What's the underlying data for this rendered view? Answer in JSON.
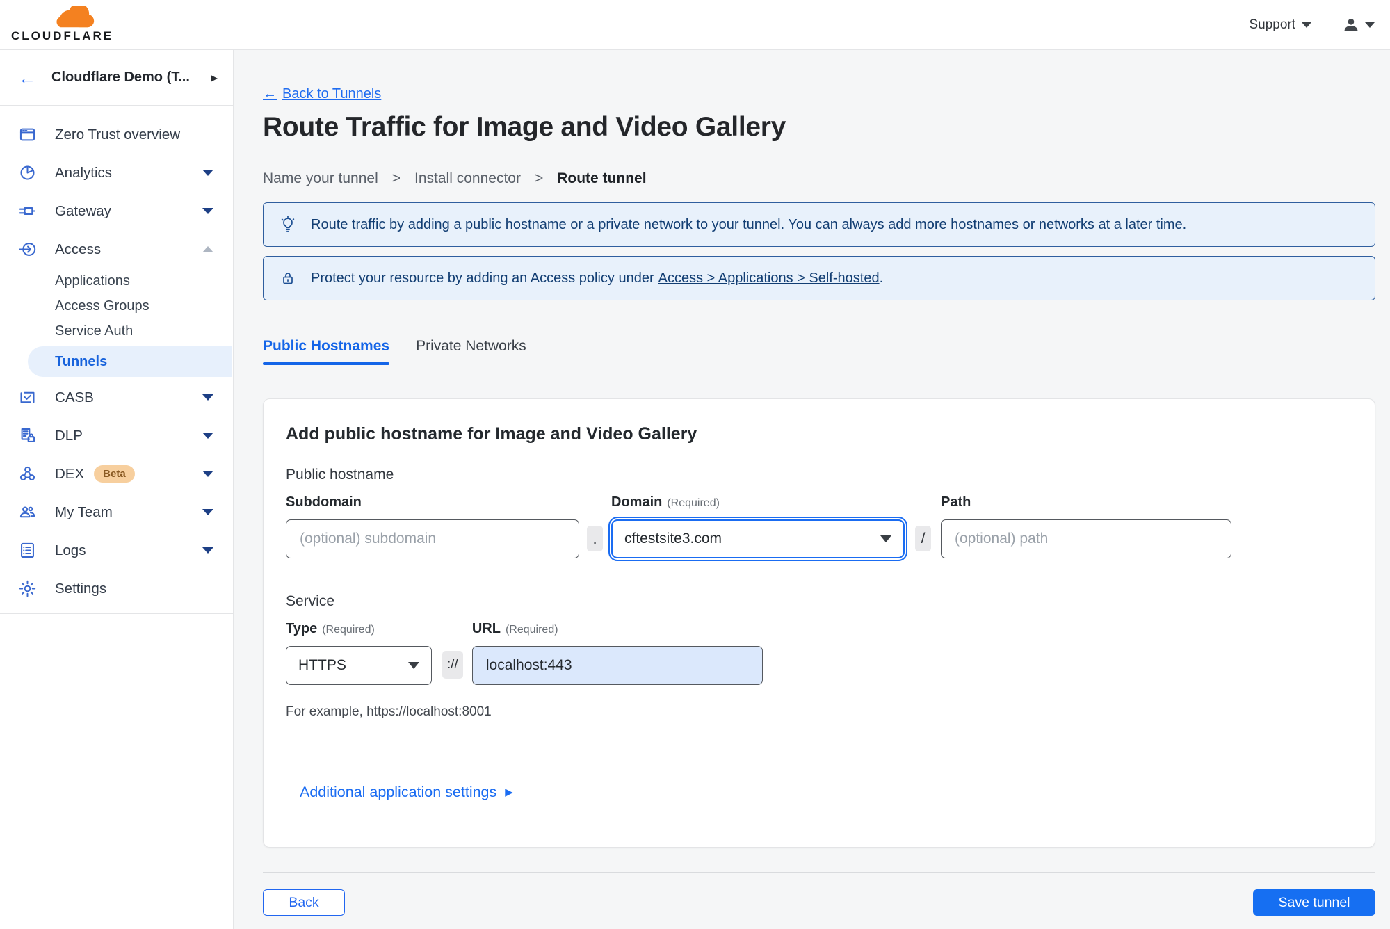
{
  "colors": {
    "accent_blue": "#1a6cf2",
    "save_button_blue": "#166ff2",
    "banner_bg": "#e8f1fb",
    "banner_border": "#2f5e9e",
    "banner_text": "#123e73",
    "sidebar_icon_blue": "#3968cf",
    "active_pill_bg": "#e7f0fc",
    "beta_badge_bg": "#f7cf9e",
    "url_input_bg": "#dbe8fc"
  },
  "icons": {
    "back_arrow": "←",
    "chevron_right": "▶",
    "breadcrumb_sep": ">",
    "details_caret": "▶"
  },
  "header": {
    "brand": "CLOUDFLARE",
    "support_label": "Support"
  },
  "sidebar": {
    "account": "Cloudflare Demo (T...",
    "items": [
      {
        "label": "Zero Trust overview"
      },
      {
        "label": "Analytics"
      },
      {
        "label": "Gateway"
      },
      {
        "label": "Access"
      },
      {
        "label": "CASB"
      },
      {
        "label": "DLP"
      },
      {
        "label": "DEX",
        "badge": "Beta"
      },
      {
        "label": "My Team"
      },
      {
        "label": "Logs"
      },
      {
        "label": "Settings"
      }
    ],
    "access_subitems": [
      {
        "label": "Applications"
      },
      {
        "label": "Access Groups"
      },
      {
        "label": "Service Auth"
      },
      {
        "label": "Tunnels"
      }
    ]
  },
  "main": {
    "back_link": "Back to Tunnels",
    "title": "Route Traffic for Image and Video Gallery",
    "steps": [
      {
        "label": "Name your tunnel"
      },
      {
        "label": "Install connector"
      },
      {
        "label": "Route tunnel"
      }
    ],
    "banners": [
      {
        "text": "Route traffic by adding a public hostname or a private network to your tunnel. You can always add more hostnames or networks at a later time."
      },
      {
        "prefix": "Protect your resource by adding an Access policy under",
        "link": "Access > Applications > Self-hosted",
        "suffix": "."
      }
    ],
    "tabs": [
      {
        "label": "Public Hostnames"
      },
      {
        "label": "Private Networks"
      }
    ],
    "card": {
      "title": "Add public hostname for Image and Video Gallery",
      "hostname_section": "Public hostname",
      "required_label": "(Required)",
      "subdomain": {
        "label": "Subdomain",
        "placeholder": "(optional) subdomain"
      },
      "dot_separator": ".",
      "domain": {
        "label": "Domain",
        "value": "cftestsite3.com"
      },
      "slash_separator": "/",
      "path": {
        "label": "Path",
        "placeholder": "(optional) path"
      },
      "service_section": "Service",
      "type": {
        "label": "Type",
        "value": "HTTPS"
      },
      "protocol_separator": "://",
      "url": {
        "label": "URL",
        "value": "localhost:443"
      },
      "example": "For example, https://localhost:8001",
      "additional_settings": "Additional application settings"
    },
    "back_button": "Back",
    "save_button": "Save tunnel"
  }
}
